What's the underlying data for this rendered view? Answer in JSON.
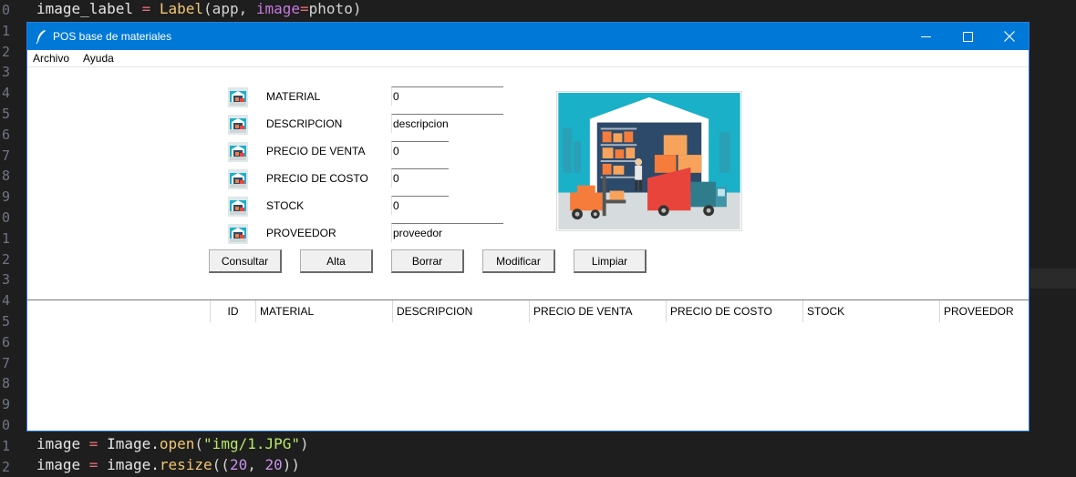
{
  "editor": {
    "line_numbers": [
      "0",
      "1",
      "2",
      "3",
      "4",
      "5",
      "6",
      "7",
      "8",
      "9",
      "0",
      "1",
      "2",
      "3",
      "4",
      "5",
      "6",
      "7",
      "8",
      "9",
      "0",
      "1",
      "2"
    ],
    "top_line": {
      "var": "image_label",
      "op": " = ",
      "fn": "Label",
      "arg1": "(app, ",
      "kw": "image",
      "eq": "=",
      "arg2": "photo)"
    },
    "bottom_line_1": {
      "var": "image",
      "op": " = ",
      "obj": "Image.",
      "fn": "open",
      "open": "(",
      "str": "\"img/1.JPG\"",
      "close": ")"
    },
    "bottom_line_2": {
      "var": "image",
      "op": " = ",
      "obj": "image.",
      "fn": "resize",
      "open": "((",
      "n1": "20",
      "comma": ", ",
      "n2": "20",
      "close": "))"
    }
  },
  "window": {
    "title": "POS base de materiales",
    "title_icon": "feather-icon",
    "controls": {
      "minimize": "—",
      "maximize": "☐",
      "close": "✕"
    }
  },
  "menu": [
    {
      "label": "Archivo"
    },
    {
      "label": "Ayuda"
    }
  ],
  "form": {
    "fields": [
      {
        "label": "MATERIAL",
        "value": "0"
      },
      {
        "label": "DESCRIPCION",
        "value": "descripcion"
      },
      {
        "label": "PRECIO DE VENTA",
        "value": "0"
      },
      {
        "label": "PRECIO DE COSTO",
        "value": "0"
      },
      {
        "label": "STOCK",
        "value": "0"
      },
      {
        "label": "PROVEEDOR",
        "value": "proveedor"
      }
    ]
  },
  "buttons": [
    {
      "label": "Consultar"
    },
    {
      "label": "Alta"
    },
    {
      "label": "Borrar"
    },
    {
      "label": "Modificar"
    },
    {
      "label": "Limpiar"
    }
  ],
  "table": {
    "columns": [
      "ID",
      "MATERIAL",
      "DESCRIPCION",
      "PRECIO DE VENTA",
      "PRECIO DE COSTO",
      "STOCK",
      "PROVEEDOR"
    ],
    "rows": []
  },
  "colors": {
    "titlebar": "#0078d7",
    "warehouse_sky": "#1ab0c8",
    "forklift_orange": "#f57c3a",
    "truck_red": "#e8443c",
    "truck_teal": "#2f7c8c"
  }
}
